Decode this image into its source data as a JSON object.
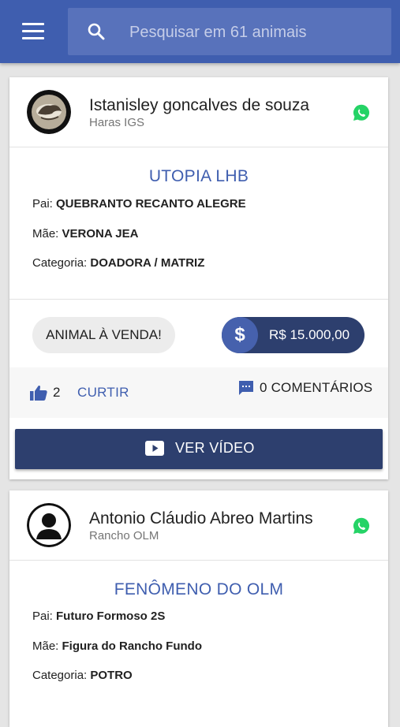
{
  "search": {
    "placeholder": "Pesquisar em 61 animais"
  },
  "listings": [
    {
      "owner": "Istanisley goncalves de souza",
      "farm": "Haras IGS",
      "animal_name": "UTOPIA LHB",
      "pai_label": "Pai: ",
      "pai": "QUEBRANTO RECANTO ALEGRE",
      "mae_label": "Mãe: ",
      "mae": "VERONA JEA",
      "categoria_label": "Categoria: ",
      "categoria": "DOADORA / MATRIZ",
      "sale_label": "ANIMAL À VENDA!",
      "price_symbol": "$",
      "price": "R$ 15.000,00",
      "likes": "2",
      "like_label": "CURTIR",
      "comments_label": "0 COMENTÁRIOS",
      "video_label": "VER VÍDEO"
    },
    {
      "owner": "Antonio Cláudio Abreo Martins",
      "farm": "Rancho OLM",
      "animal_name": "FENÔMENO DO OLM",
      "pai_label": "Pai: ",
      "pai": "Futuro Formoso 2S",
      "mae_label": "Mãe: ",
      "mae": "Figura do Rancho Fundo",
      "categoria_label": "Categoria: ",
      "categoria": "POTRO"
    }
  ],
  "icons": {
    "menu": "hamburger-icon",
    "search": "search-icon",
    "whatsapp": "whatsapp-icon",
    "like": "thumbs-up-icon",
    "comment": "comment-icon",
    "video": "play-icon"
  },
  "colors": {
    "topbar": "#3f5eaf",
    "accent": "#3f5eaf",
    "dark_button": "#2d3f6e",
    "whatsapp": "#25d366"
  }
}
